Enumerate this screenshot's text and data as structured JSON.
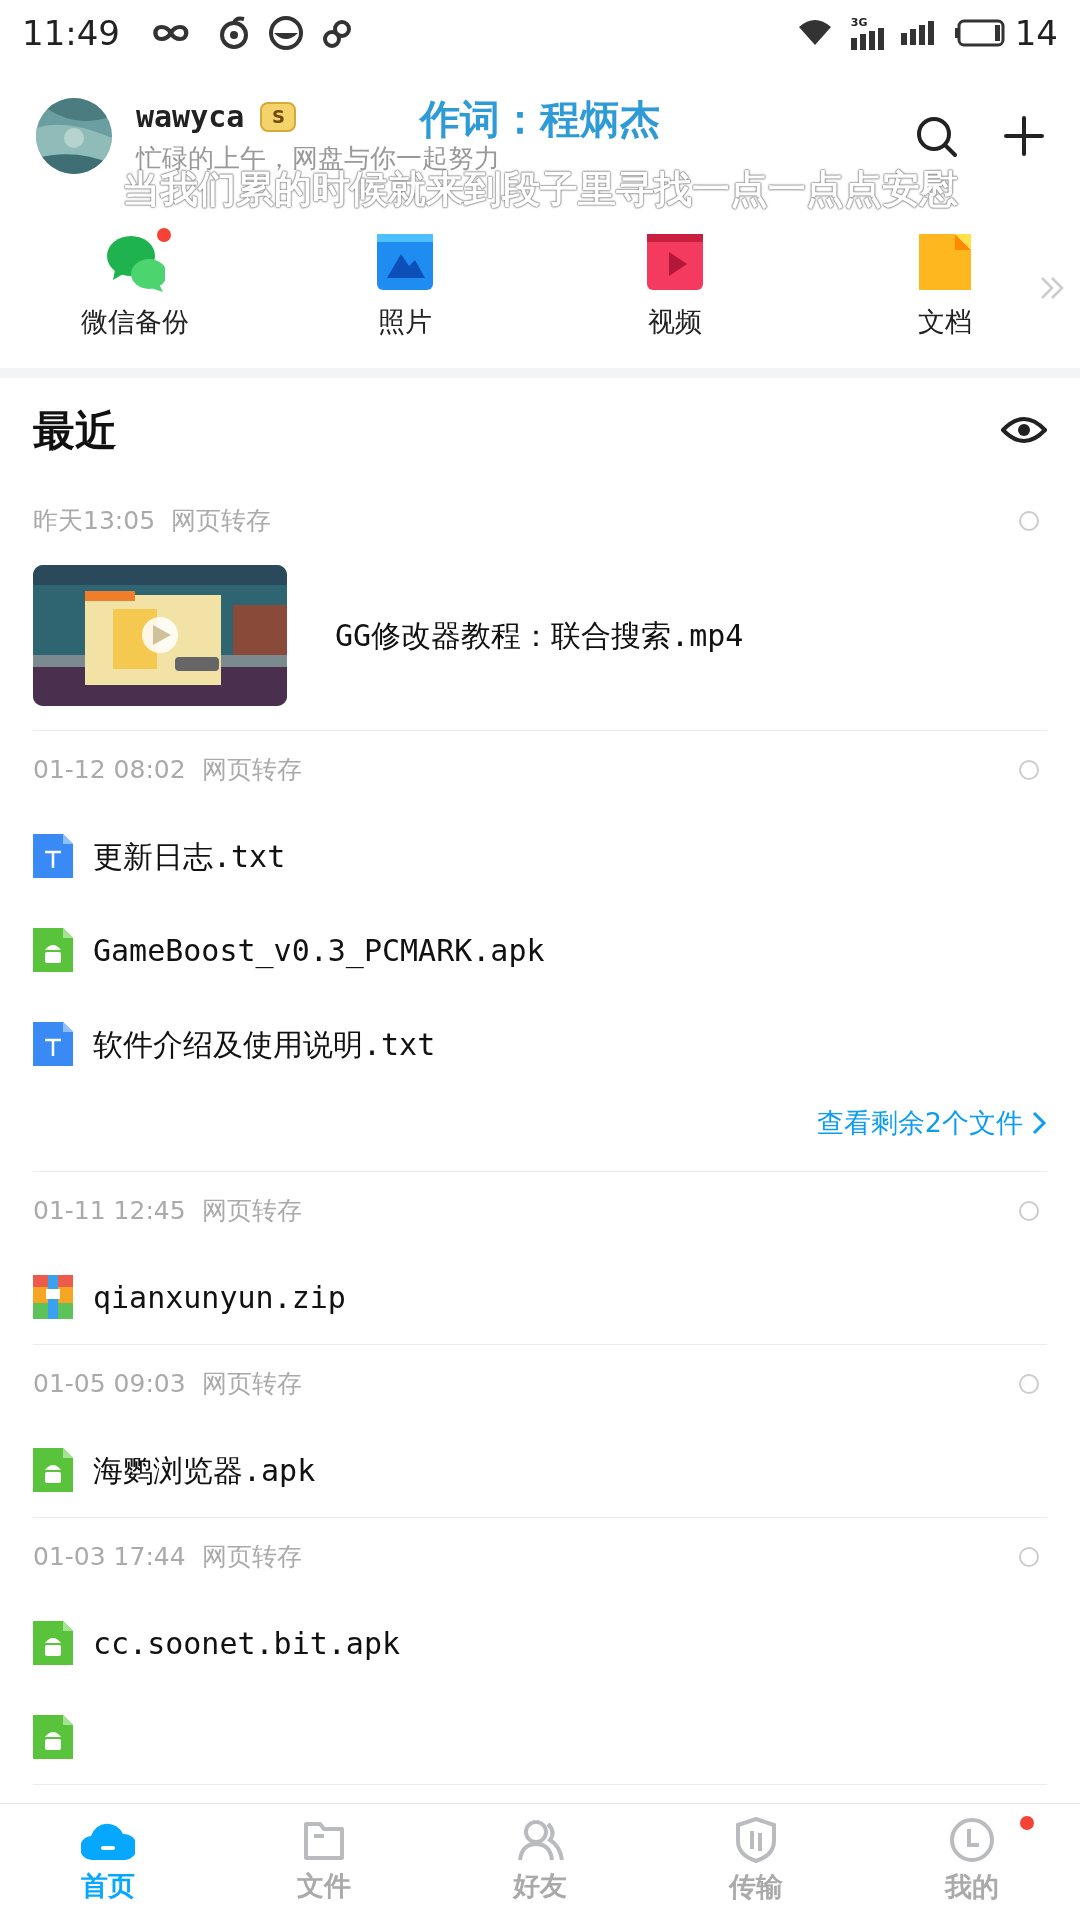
{
  "status_bar": {
    "time": "11:49",
    "network": "3G",
    "battery": "14"
  },
  "user": {
    "name": "wawyca",
    "vip_badge": "S",
    "subtitle": "忙碌的上午，网盘与你一起努力"
  },
  "floating_lyrics": [
    "作词：程炳杰",
    "当我们累的时候就来到段子里寻找一点一点点安慰"
  ],
  "quick_access": [
    {
      "kind": "wechat",
      "label": "微信备份",
      "dot": true
    },
    {
      "label": "照片",
      "dot": false
    },
    {
      "kind": "video",
      "label": "视频",
      "dot": false
    },
    {
      "kind": "doc",
      "label": "文档",
      "dot": false
    }
  ],
  "recent": {
    "title": "最近",
    "groups": [
      {
        "time": "昨天13:05",
        "source": "网页转存",
        "selected": false,
        "files": [
          {
            "kind": "video",
            "name": "GG修改器教程：联合搜索.mp4"
          }
        ]
      },
      {
        "time": "01-12 08:02",
        "source": "网页转存",
        "selected": false,
        "files": [
          {
            "kind": "txt",
            "name": "更新日志.txt"
          },
          {
            "kind": "apk",
            "name": "GameBoost_v0.3_PCMARK.apk"
          },
          {
            "kind": "txt",
            "name": "软件介绍及使用说明.txt"
          }
        ],
        "more_link": "查看剩余2个文件"
      },
      {
        "time": "01-11 12:45",
        "source": "网页转存",
        "selected": false,
        "files": [
          {
            "kind": "zip",
            "name": "qianxunyun.zip"
          }
        ]
      },
      {
        "time": "01-05 09:03",
        "source": "网页转存",
        "selected": false,
        "files": [
          {
            "kind": "apk",
            "name": "海鹦浏览器.apk"
          }
        ]
      },
      {
        "time": "01-03 17:44",
        "source": "网页转存",
        "selected": false,
        "files": [
          {
            "kind": "apk",
            "name": "cc.soonet.bit.apk"
          },
          {
            "kind": "apk"
          }
        ]
      }
    ]
  },
  "bottom_nav": [
    {
      "kind": "home",
      "label": "首页",
      "selected": true,
      "dot": false
    },
    {
      "kind": "files",
      "label": "文件",
      "selected": false,
      "dot": false
    },
    {
      "kind": "friends",
      "label": "好友",
      "selected": false,
      "dot": false
    },
    {
      "kind": "transfer",
      "label": "传输",
      "selected": false,
      "dot": false
    },
    {
      "kind": "me",
      "label": "我的",
      "selected": false,
      "dot": true
    }
  ]
}
